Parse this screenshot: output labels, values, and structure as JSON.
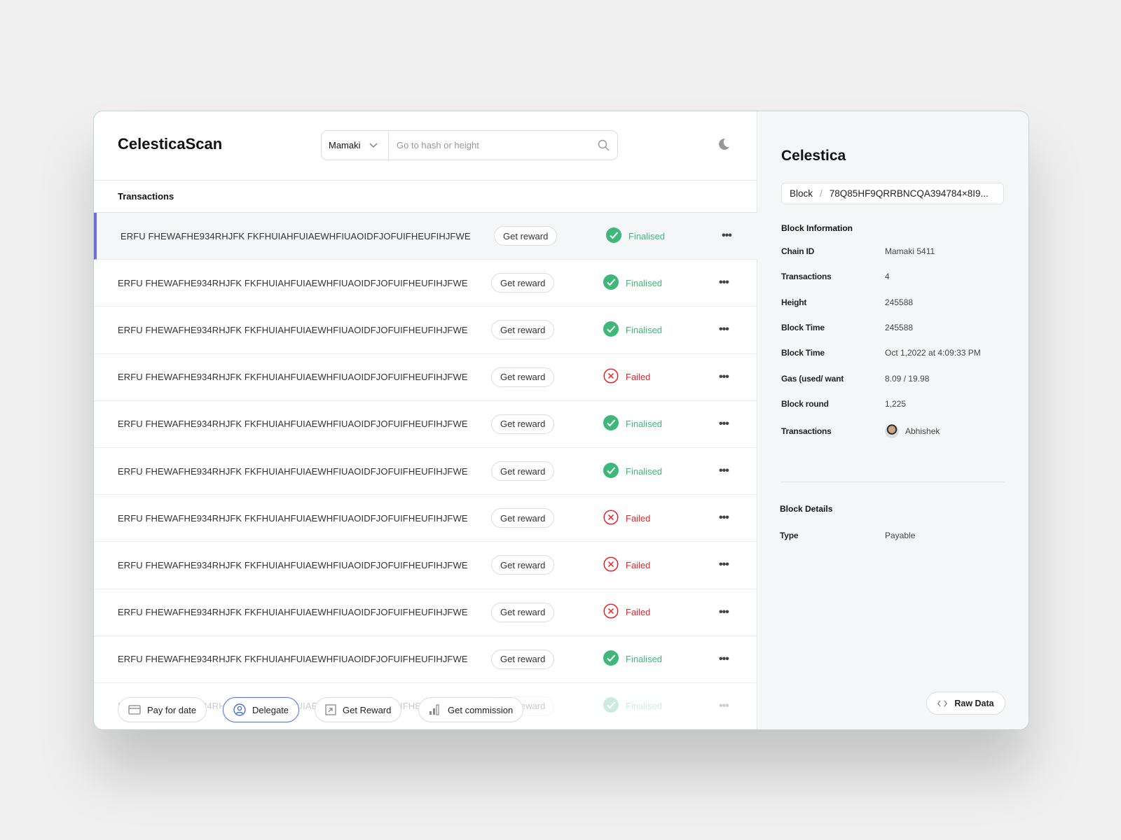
{
  "header": {
    "logo": "CelesticaScan",
    "network": "Mamaki",
    "search_placeholder": "Go to hash or height"
  },
  "section_title": "Transactions",
  "rows": [
    {
      "hash": "ERFU FHEWAFHE934RHJFK FKFHUIAHFUIAEWHFIUAOIDFJOFUIFHEUFIHJFWE",
      "action": "Get reward",
      "status": "Finalised",
      "ok": true
    },
    {
      "hash": "ERFU FHEWAFHE934RHJFK FKFHUIAHFUIAEWHFIUAOIDFJOFUIFHEUFIHJFWE",
      "action": "Get reward",
      "status": "Finalised",
      "ok": true
    },
    {
      "hash": "ERFU FHEWAFHE934RHJFK FKFHUIAHFUIAEWHFIUAOIDFJOFUIFHEUFIHJFWE",
      "action": "Get reward",
      "status": "Finalised",
      "ok": true
    },
    {
      "hash": "ERFU FHEWAFHE934RHJFK FKFHUIAHFUIAEWHFIUAOIDFJOFUIFHEUFIHJFWE",
      "action": "Get reward",
      "status": "Failed",
      "ok": false
    },
    {
      "hash": "ERFU FHEWAFHE934RHJFK FKFHUIAHFUIAEWHFIUAOIDFJOFUIFHEUFIHJFWE",
      "action": "Get reward",
      "status": "Finalised",
      "ok": true
    },
    {
      "hash": "ERFU FHEWAFHE934RHJFK FKFHUIAHFUIAEWHFIUAOIDFJOFUIFHEUFIHJFWE",
      "action": "Get reward",
      "status": "Finalised",
      "ok": true
    },
    {
      "hash": "ERFU FHEWAFHE934RHJFK FKFHUIAHFUIAEWHFIUAOIDFJOFUIFHEUFIHJFWE",
      "action": "Get reward",
      "status": "Failed",
      "ok": false
    },
    {
      "hash": "ERFU FHEWAFHE934RHJFK FKFHUIAHFUIAEWHFIUAOIDFJOFUIFHEUFIHJFWE",
      "action": "Get reward",
      "status": "Failed",
      "ok": false
    },
    {
      "hash": "ERFU FHEWAFHE934RHJFK FKFHUIAHFUIAEWHFIUAOIDFJOFUIFHEUFIHJFWE",
      "action": "Get reward",
      "status": "Failed",
      "ok": false
    },
    {
      "hash": "ERFU FHEWAFHE934RHJFK FKFHUIAHFUIAEWHFIUAOIDFJOFUIFHEUFIHJFWE",
      "action": "Get reward",
      "status": "Finalised",
      "ok": true
    },
    {
      "hash": "ERFU FHEWAFHE934RHJFK FKFHUIAHFUIAEWHFIUAOIDFJOFUIFHEUFIHJFWE",
      "action": "Get reward",
      "status": "Finalised",
      "ok": true
    }
  ],
  "actions": [
    {
      "label": "Pay for date",
      "icon": "card-icon"
    },
    {
      "label": "Delegate",
      "icon": "user-circle-icon"
    },
    {
      "label": "Get Reward",
      "icon": "external-link-icon"
    },
    {
      "label": "Get commission",
      "icon": "bar-chart-icon"
    }
  ],
  "panel": {
    "title": "Celestica",
    "crumb_root": "Block",
    "crumb_sep": "/",
    "crumb_hash": "78Q85HF9QRRBNCQA394784×8I9...",
    "info_title": "Block Information",
    "info": [
      {
        "k": "Chain ID",
        "v": "Mamaki 5411"
      },
      {
        "k": "Transactions",
        "v": "4"
      },
      {
        "k": "Height",
        "v": "245588"
      },
      {
        "k": "Block Time",
        "v": "245588"
      },
      {
        "k": "Block Time",
        "v": "Oct 1,2022 at 4:09:33 PM"
      },
      {
        "k": "Gas (used/ want",
        "v": "8.09 / 19.98"
      },
      {
        "k": "Block round",
        "v": "1,225"
      },
      {
        "k": "Transactions",
        "v": "Abhishek"
      }
    ],
    "details_title": "Block Details",
    "details": [
      {
        "k": "Type",
        "v": "Payable"
      }
    ],
    "raw_label": "Raw Data"
  },
  "colors": {
    "success": "#3fb77a",
    "fail": "#e8232b",
    "accent": "#6b6ee0"
  }
}
